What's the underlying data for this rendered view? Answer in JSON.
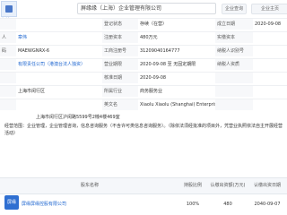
{
  "header": {
    "search_value": "屏缘缘（上海）企业管理有限公司",
    "btn_a": "企业查询",
    "btn_b": "企业主页"
  },
  "sidebar_tags": [
    "存续",
    "开业"
  ],
  "rows": [
    {
      "c1": "",
      "c2": "",
      "c3": "登记状态",
      "c4": "存续（在营）",
      "c5": "成立日期",
      "c6": "2020-09-08"
    },
    {
      "c1": "人",
      "c2": "章伟",
      "c3": "注册资本",
      "c4": "480万元",
      "c5": "实缴资本",
      "c6": ""
    },
    {
      "c1": "码",
      "c2": "MAEWGNRX-6",
      "c3": "工商注册号",
      "c4": "31209040164777",
      "c5": "纳税人识别号",
      "c6": ""
    },
    {
      "c1": "",
      "c2": "有限责任公司（港澳台法人独资）",
      "c3": "营业期限",
      "c4": "2020-09-08 至 无固定期限",
      "c5": "纳税人资质",
      "c6": ""
    },
    {
      "c1": "",
      "c2": "",
      "c3": "核准日期",
      "c4": "2020-09-08",
      "c5": "",
      "c6": ""
    },
    {
      "c1": "",
      "c2": "上海市闵行区",
      "c3": "所属行业",
      "c4": "商务服务业",
      "c5": "",
      "c6": ""
    },
    {
      "c1": "",
      "c2": "",
      "c3": "英文名",
      "c4": "Xiaolu Xiaolu (Shanghai) Enterprise Management Co., Ltd.",
      "c5": "",
      "c6": ""
    }
  ],
  "address": "上海市闵行区沪闵路5599号2幢4楼469室",
  "scope_text": "经营范围：企业管理，企业管理咨询，信息咨询服务（不含许可类信息咨询服务）。（除依法须经批准的项目外，凭营业执照依法自主开展经营活动）",
  "shareholders": {
    "headers": [
      "股东名称",
      "持股比例",
      "认缴出资额(万元)",
      "认缴出资日期"
    ],
    "row": {
      "name": "屏缘屏缘控股有限公司",
      "pct": "100%",
      "amount": "480",
      "date": "2040-09-07",
      "logo_text": "屏缘"
    }
  }
}
